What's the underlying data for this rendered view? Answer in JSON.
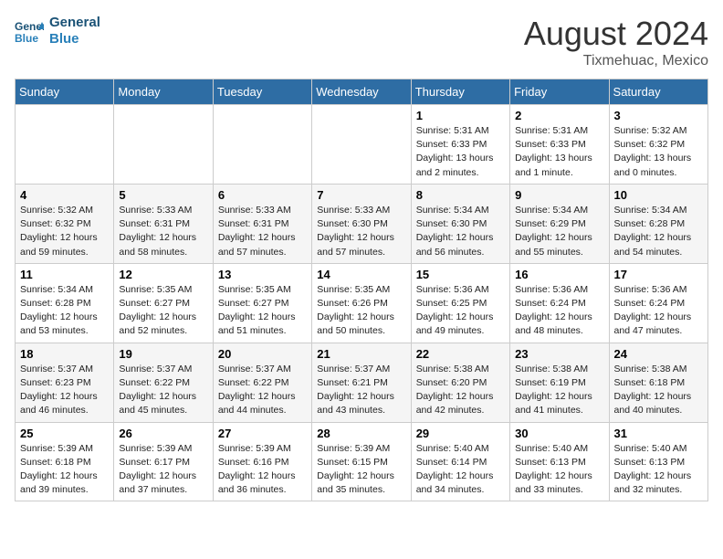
{
  "header": {
    "logo_line1": "General",
    "logo_line2": "Blue",
    "month_year": "August 2024",
    "location": "Tixmehuac, Mexico"
  },
  "days_of_week": [
    "Sunday",
    "Monday",
    "Tuesday",
    "Wednesday",
    "Thursday",
    "Friday",
    "Saturday"
  ],
  "weeks": [
    [
      {
        "day": "",
        "info": ""
      },
      {
        "day": "",
        "info": ""
      },
      {
        "day": "",
        "info": ""
      },
      {
        "day": "",
        "info": ""
      },
      {
        "day": "1",
        "info": "Sunrise: 5:31 AM\nSunset: 6:33 PM\nDaylight: 13 hours\nand 2 minutes."
      },
      {
        "day": "2",
        "info": "Sunrise: 5:31 AM\nSunset: 6:33 PM\nDaylight: 13 hours\nand 1 minute."
      },
      {
        "day": "3",
        "info": "Sunrise: 5:32 AM\nSunset: 6:32 PM\nDaylight: 13 hours\nand 0 minutes."
      }
    ],
    [
      {
        "day": "4",
        "info": "Sunrise: 5:32 AM\nSunset: 6:32 PM\nDaylight: 12 hours\nand 59 minutes."
      },
      {
        "day": "5",
        "info": "Sunrise: 5:33 AM\nSunset: 6:31 PM\nDaylight: 12 hours\nand 58 minutes."
      },
      {
        "day": "6",
        "info": "Sunrise: 5:33 AM\nSunset: 6:31 PM\nDaylight: 12 hours\nand 57 minutes."
      },
      {
        "day": "7",
        "info": "Sunrise: 5:33 AM\nSunset: 6:30 PM\nDaylight: 12 hours\nand 57 minutes."
      },
      {
        "day": "8",
        "info": "Sunrise: 5:34 AM\nSunset: 6:30 PM\nDaylight: 12 hours\nand 56 minutes."
      },
      {
        "day": "9",
        "info": "Sunrise: 5:34 AM\nSunset: 6:29 PM\nDaylight: 12 hours\nand 55 minutes."
      },
      {
        "day": "10",
        "info": "Sunrise: 5:34 AM\nSunset: 6:28 PM\nDaylight: 12 hours\nand 54 minutes."
      }
    ],
    [
      {
        "day": "11",
        "info": "Sunrise: 5:34 AM\nSunset: 6:28 PM\nDaylight: 12 hours\nand 53 minutes."
      },
      {
        "day": "12",
        "info": "Sunrise: 5:35 AM\nSunset: 6:27 PM\nDaylight: 12 hours\nand 52 minutes."
      },
      {
        "day": "13",
        "info": "Sunrise: 5:35 AM\nSunset: 6:27 PM\nDaylight: 12 hours\nand 51 minutes."
      },
      {
        "day": "14",
        "info": "Sunrise: 5:35 AM\nSunset: 6:26 PM\nDaylight: 12 hours\nand 50 minutes."
      },
      {
        "day": "15",
        "info": "Sunrise: 5:36 AM\nSunset: 6:25 PM\nDaylight: 12 hours\nand 49 minutes."
      },
      {
        "day": "16",
        "info": "Sunrise: 5:36 AM\nSunset: 6:24 PM\nDaylight: 12 hours\nand 48 minutes."
      },
      {
        "day": "17",
        "info": "Sunrise: 5:36 AM\nSunset: 6:24 PM\nDaylight: 12 hours\nand 47 minutes."
      }
    ],
    [
      {
        "day": "18",
        "info": "Sunrise: 5:37 AM\nSunset: 6:23 PM\nDaylight: 12 hours\nand 46 minutes."
      },
      {
        "day": "19",
        "info": "Sunrise: 5:37 AM\nSunset: 6:22 PM\nDaylight: 12 hours\nand 45 minutes."
      },
      {
        "day": "20",
        "info": "Sunrise: 5:37 AM\nSunset: 6:22 PM\nDaylight: 12 hours\nand 44 minutes."
      },
      {
        "day": "21",
        "info": "Sunrise: 5:37 AM\nSunset: 6:21 PM\nDaylight: 12 hours\nand 43 minutes."
      },
      {
        "day": "22",
        "info": "Sunrise: 5:38 AM\nSunset: 6:20 PM\nDaylight: 12 hours\nand 42 minutes."
      },
      {
        "day": "23",
        "info": "Sunrise: 5:38 AM\nSunset: 6:19 PM\nDaylight: 12 hours\nand 41 minutes."
      },
      {
        "day": "24",
        "info": "Sunrise: 5:38 AM\nSunset: 6:18 PM\nDaylight: 12 hours\nand 40 minutes."
      }
    ],
    [
      {
        "day": "25",
        "info": "Sunrise: 5:39 AM\nSunset: 6:18 PM\nDaylight: 12 hours\nand 39 minutes."
      },
      {
        "day": "26",
        "info": "Sunrise: 5:39 AM\nSunset: 6:17 PM\nDaylight: 12 hours\nand 37 minutes."
      },
      {
        "day": "27",
        "info": "Sunrise: 5:39 AM\nSunset: 6:16 PM\nDaylight: 12 hours\nand 36 minutes."
      },
      {
        "day": "28",
        "info": "Sunrise: 5:39 AM\nSunset: 6:15 PM\nDaylight: 12 hours\nand 35 minutes."
      },
      {
        "day": "29",
        "info": "Sunrise: 5:40 AM\nSunset: 6:14 PM\nDaylight: 12 hours\nand 34 minutes."
      },
      {
        "day": "30",
        "info": "Sunrise: 5:40 AM\nSunset: 6:13 PM\nDaylight: 12 hours\nand 33 minutes."
      },
      {
        "day": "31",
        "info": "Sunrise: 5:40 AM\nSunset: 6:13 PM\nDaylight: 12 hours\nand 32 minutes."
      }
    ]
  ]
}
